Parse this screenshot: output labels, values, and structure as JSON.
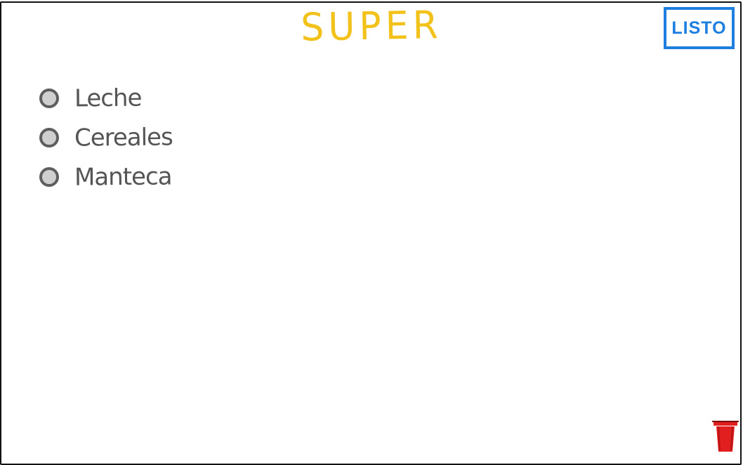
{
  "header": {
    "title": "SUPER",
    "title_color": "#f2c21b"
  },
  "toolbar": {
    "done_label": "LISTO",
    "accent": "#1e7fe0"
  },
  "list": {
    "items": [
      {
        "label": "Leche",
        "checked": false
      },
      {
        "label": "Cereales",
        "checked": false
      },
      {
        "label": "Manteca",
        "checked": false
      }
    ]
  },
  "footer": {
    "trash_icon": "trash-icon",
    "trash_color": "#e21f1f"
  }
}
